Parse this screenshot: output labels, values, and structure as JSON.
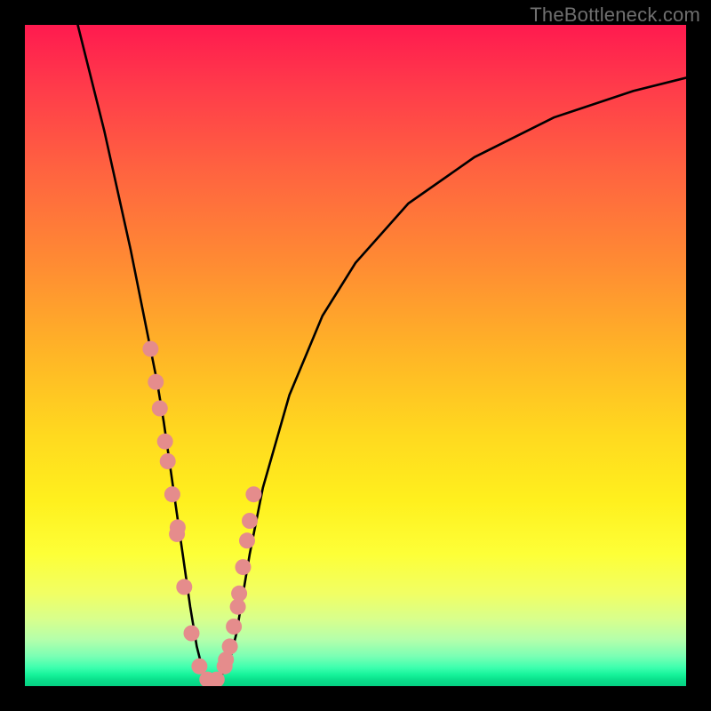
{
  "watermark": "TheBottleneck.com",
  "chart_data": {
    "type": "line",
    "title": "",
    "xlabel": "",
    "ylabel": "",
    "xlim": [
      0,
      100
    ],
    "ylim": [
      0,
      100
    ],
    "background_gradient": {
      "top_color": "#ff1a4f",
      "mid_color": "#ffd91f",
      "bottom_color": "#05d183",
      "description": "vertical rainbow gradient (red→orange→yellow→green) indicating bottleneck severity, red=high, green=low"
    },
    "series": [
      {
        "name": "bottleneck-curve",
        "description": "V-shaped bottleneck curve; minimum near x≈27 where bottleneck ≈0, rising steeply toward both sides",
        "x": [
          8,
          12,
          16,
          18,
          20,
          21,
          22,
          23,
          24,
          25,
          26,
          27,
          28,
          29,
          30,
          31,
          32,
          33,
          34,
          36,
          40,
          45,
          50,
          58,
          68,
          80,
          92,
          100
        ],
        "values": [
          100,
          84,
          66,
          56,
          46,
          40,
          33,
          26,
          19,
          12,
          6,
          2,
          1,
          1,
          2,
          4,
          8,
          14,
          20,
          30,
          44,
          56,
          64,
          73,
          80,
          86,
          90,
          92
        ]
      }
    ],
    "scatter_points": {
      "name": "sample-points",
      "description": "salmon dots indicating sampled hardware points along the curve, clustered near the minimum and along the steep flanks",
      "x": [
        19.0,
        19.8,
        20.4,
        21.2,
        21.6,
        22.3,
        23.0,
        23.1,
        24.1,
        25.2,
        26.4,
        27.6,
        29.0,
        30.2,
        30.4,
        31.0,
        31.6,
        32.2,
        32.4,
        33.0,
        33.6,
        34.0,
        34.6
      ],
      "values": [
        51,
        46,
        42,
        37,
        34,
        29,
        23,
        24,
        15,
        8,
        3,
        1,
        1,
        3,
        4,
        6,
        9,
        12,
        14,
        18,
        22,
        25,
        29
      ]
    }
  }
}
